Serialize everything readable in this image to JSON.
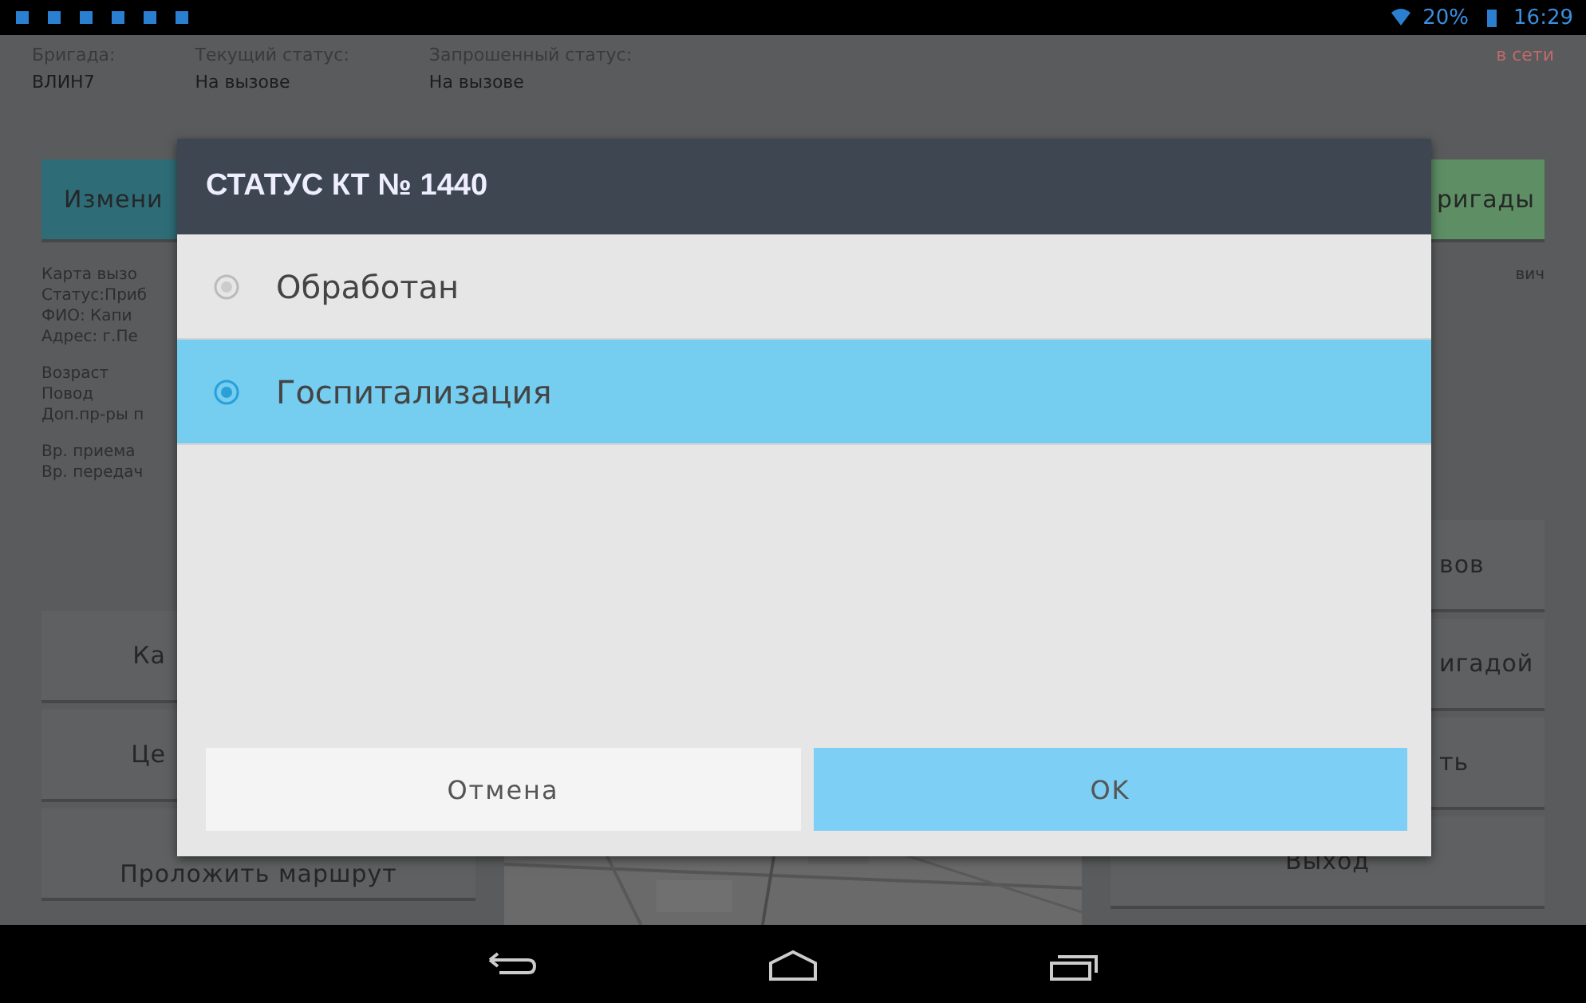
{
  "status_bar": {
    "battery": "20%",
    "time": "16:29"
  },
  "header": {
    "fields": [
      {
        "label": "Бригада:",
        "value": "ВЛИН7"
      },
      {
        "label": "Текущий статус:",
        "value": "На вызове"
      },
      {
        "label": "Запрошенный статус:",
        "value": "На вызове"
      }
    ],
    "connection": "в сети"
  },
  "top_buttons": [
    {
      "label": "Измени",
      "kind": "primary"
    },
    {
      "label": "ригады",
      "kind": "success"
    }
  ],
  "call_card": {
    "lines": [
      "Карта вызо",
      "Статус:Приб",
      "ФИО: Капи",
      "Адрес: г.Пе"
    ],
    "details": [
      "Возраст",
      "Повод",
      "Доп.пр-ры п"
    ],
    "times": [
      "Вр. приема",
      "Вр. передач"
    ],
    "right_text": "вич"
  },
  "left_buttons": [
    "Ка",
    "Це",
    "Проложить маршрут"
  ],
  "right_buttons": [
    "вов",
    "игадой",
    "ть",
    "Выход"
  ],
  "map": {
    "kind": "picture"
  },
  "dialog": {
    "title": "СТАТУС КТ № 1440",
    "options": [
      {
        "label": "Обработан",
        "selected": false
      },
      {
        "label": "Госпитализация",
        "selected": true
      }
    ],
    "buttons": [
      {
        "label": "Отмена",
        "kind": "cancel"
      },
      {
        "label": "OK",
        "kind": "confirm"
      }
    ]
  }
}
